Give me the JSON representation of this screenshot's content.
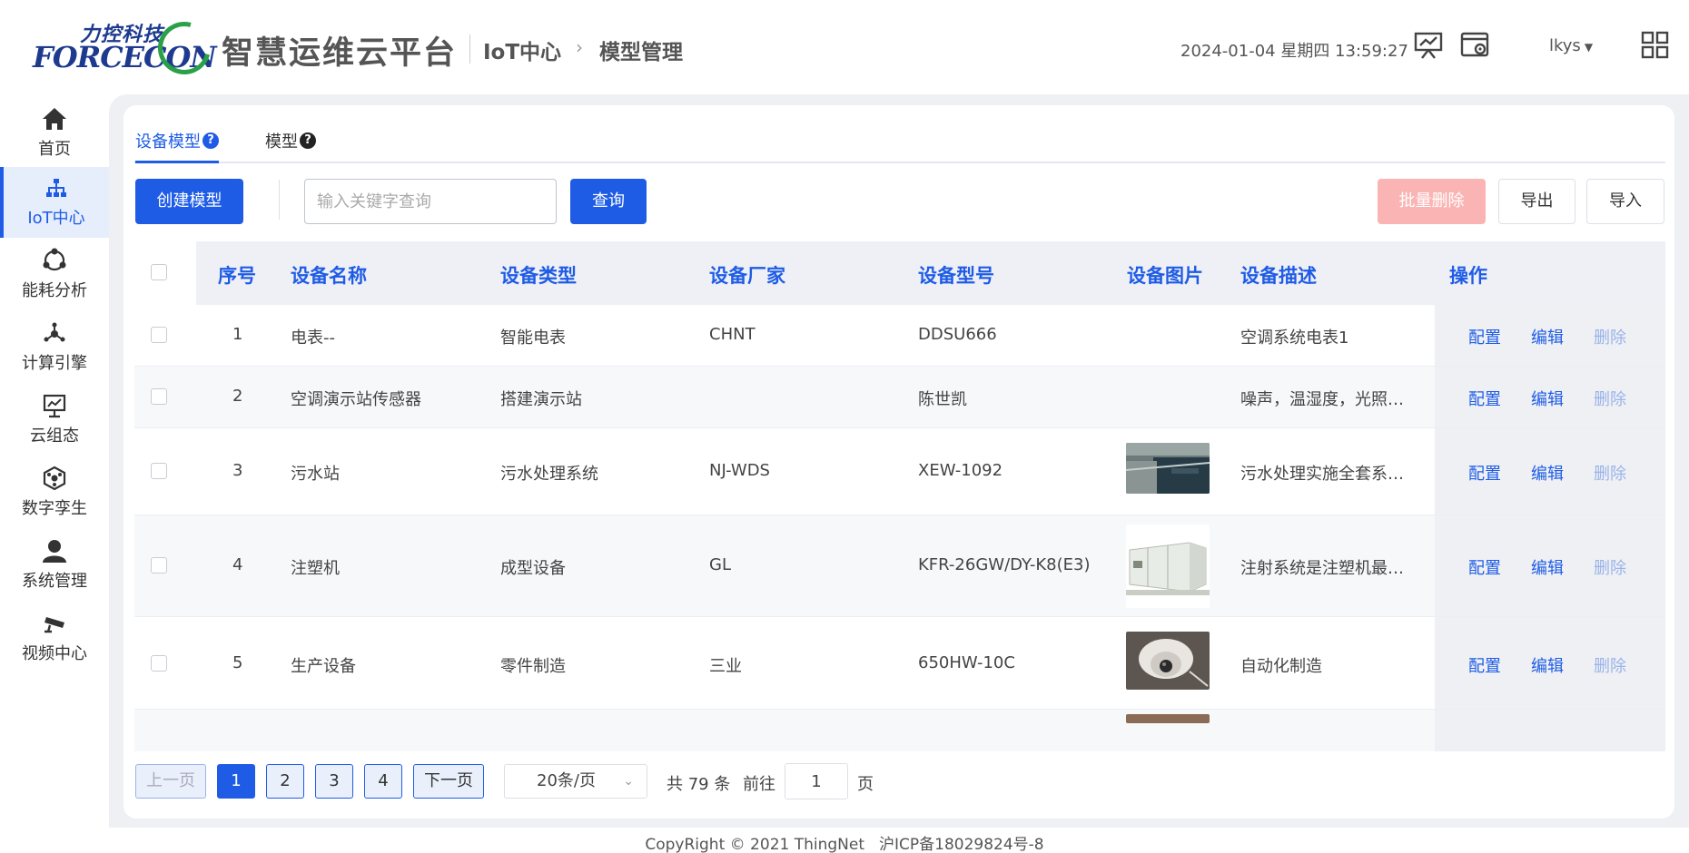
{
  "header": {
    "logo_cn": "力控科技",
    "logo_en": "FORCECON",
    "app_title": "智慧运维云平台",
    "breadcrumb": [
      "IoT中心",
      "模型管理"
    ],
    "datetime": "2024-01-04 星期四 13:59:27",
    "user": "lkys",
    "icons": [
      "presentation-icon",
      "settings-window-icon",
      "grid-apps-icon"
    ]
  },
  "sidebar": {
    "items": [
      {
        "label": "首页",
        "icon": "home-icon"
      },
      {
        "label": "IoT中心",
        "icon": "network-icon",
        "active": true
      },
      {
        "label": "能耗分析",
        "icon": "cycle-nodes-icon"
      },
      {
        "label": "计算引擎",
        "icon": "engine-nodes-icon"
      },
      {
        "label": "云组态",
        "icon": "monitor-icon"
      },
      {
        "label": "数字孪生",
        "icon": "cube-network-icon"
      },
      {
        "label": "系统管理",
        "icon": "user-icon"
      },
      {
        "label": "视频中心",
        "icon": "camera-icon"
      }
    ]
  },
  "tabs": [
    {
      "label": "设备模型",
      "active": true
    },
    {
      "label": "模型",
      "active": false
    }
  ],
  "toolbar": {
    "create_label": "创建模型",
    "search_placeholder": "输入关键字查询",
    "search_value": "",
    "query_label": "查询",
    "batch_delete_label": "批量删除",
    "export_label": "导出",
    "import_label": "导入"
  },
  "table": {
    "columns": [
      "序号",
      "设备名称",
      "设备类型",
      "设备厂家",
      "设备型号",
      "设备图片",
      "设备描述",
      "操作"
    ],
    "ops": {
      "config": "配置",
      "edit": "编辑",
      "delete": "删除"
    },
    "rows": [
      {
        "index": "1",
        "name": "电表--",
        "type": "智能电表",
        "vendor": "CHNT",
        "model": "DDSU666",
        "image": "",
        "desc": "空调系统电表1"
      },
      {
        "index": "2",
        "name": "空调演示站传感器",
        "type": "搭建演示站",
        "vendor": "",
        "model": "陈世凯",
        "image": "",
        "desc": "噪声，温湿度，光照，…"
      },
      {
        "index": "3",
        "name": "污水站",
        "type": "污水处理系统",
        "vendor": "NJ-WDS",
        "model": "XEW-1092",
        "image": "sewage-tank-photo",
        "desc": "污水处理实施全套系统…"
      },
      {
        "index": "4",
        "name": "注塑机",
        "type": "成型设备",
        "vendor": "GL",
        "model": "KFR-26GW/DY-K8(E3)",
        "image": "air-unit-photo",
        "desc": "注射系统是注塑机最主…"
      },
      {
        "index": "5",
        "name": "生产设备",
        "type": "零件制造",
        "vendor": "三业",
        "model": "650HW-10C",
        "image": "dome-camera-photo",
        "desc": "自动化制造"
      }
    ]
  },
  "pagination": {
    "prev_label": "上一页",
    "pages": [
      "1",
      "2",
      "3",
      "4"
    ],
    "current_page": "1",
    "next_label": "下一页",
    "page_size": "20条/页",
    "total_text": "共 79 条",
    "goto_label": "前往",
    "goto_value": "1",
    "page_suffix": "页"
  },
  "footer": {
    "copyright": "CopyRight © 2021  ThingNet",
    "icp": "沪ICP备18029824号-8"
  },
  "colors": {
    "accent": "#1f5ce6",
    "danger_disabled": "#fbb4b4",
    "logo_blue": "#1d3a8f",
    "logo_green": "#2aa047"
  }
}
